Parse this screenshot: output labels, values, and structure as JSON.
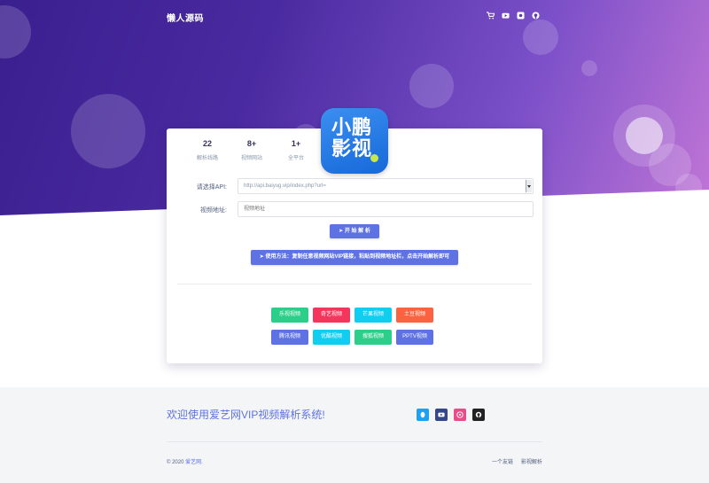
{
  "header": {
    "brand": "懒人源码",
    "icons": [
      "cart-icon",
      "youtube-icon",
      "instagram-icon",
      "github-icon"
    ]
  },
  "stats": [
    {
      "value": "22",
      "label": "解析线路"
    },
    {
      "value": "8+",
      "label": "视频网站"
    },
    {
      "value": "1+",
      "label": "全平台"
    }
  ],
  "logo": {
    "text": "小鹏影视"
  },
  "form": {
    "api_label": "请选择API:",
    "api_value": "http://api.baiyug.vip/index.php?url=",
    "video_label": "视频地址:",
    "video_placeholder": "视频地址",
    "start_button": "开 始 解 析",
    "usage_button": "使用方法：复制任意视频网站VIP链接，粘贴到视频地址栏，点击开始解析即可"
  },
  "sites": [
    {
      "label": "乐视视频",
      "color": "#2dce89"
    },
    {
      "label": "奇艺视频",
      "color": "#f5365c"
    },
    {
      "label": "芒果视频",
      "color": "#11cdef"
    },
    {
      "label": "土豆视频",
      "color": "#fb6340"
    },
    {
      "label": "腾讯视频",
      "color": "#5e72e4"
    },
    {
      "label": "优酷视频",
      "color": "#11cdef"
    },
    {
      "label": "搜狐视频",
      "color": "#2dce89"
    },
    {
      "label": "PPTV视频",
      "color": "#5e72e4"
    }
  ],
  "footer": {
    "title": "欢迎使用爱艺网VIP视频解析系统!",
    "copyright_prefix": "© 2020 ",
    "copyright_link": "爱艺网.",
    "links": [
      "一个友链",
      "影视解析"
    ],
    "social": [
      {
        "name": "qq-icon",
        "color": "#1da1f2"
      },
      {
        "name": "youtube-icon",
        "color": "#35478c"
      },
      {
        "name": "dribbble-icon",
        "color": "#ea4c89"
      },
      {
        "name": "github-icon",
        "color": "#222222"
      }
    ]
  },
  "colors": {
    "accent": "#5e72e4",
    "hero_start": "#3a1f8f",
    "hero_end": "#c276d6"
  }
}
